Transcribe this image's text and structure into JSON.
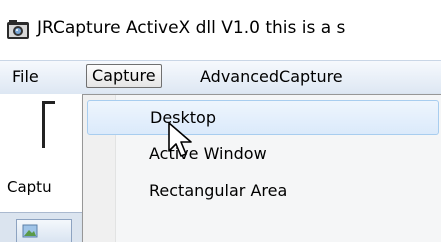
{
  "window": {
    "title": "JRCapture ActiveX dll V1.0 this is a s",
    "icon": "camera-icon"
  },
  "menubar": {
    "items": [
      {
        "label": "File"
      },
      {
        "label": "Capture"
      },
      {
        "label": "AdvancedCapture"
      }
    ]
  },
  "toolbar": {
    "label": "Captu"
  },
  "capture_menu": {
    "items": [
      {
        "label": "Desktop"
      },
      {
        "label": "Active Window"
      },
      {
        "label": "Rectangular Area"
      }
    ]
  },
  "colors": {
    "menu_highlight": "#dbeafb",
    "menu_highlight_border": "#a8cdef",
    "menubar_bg": "#dde7f3"
  }
}
